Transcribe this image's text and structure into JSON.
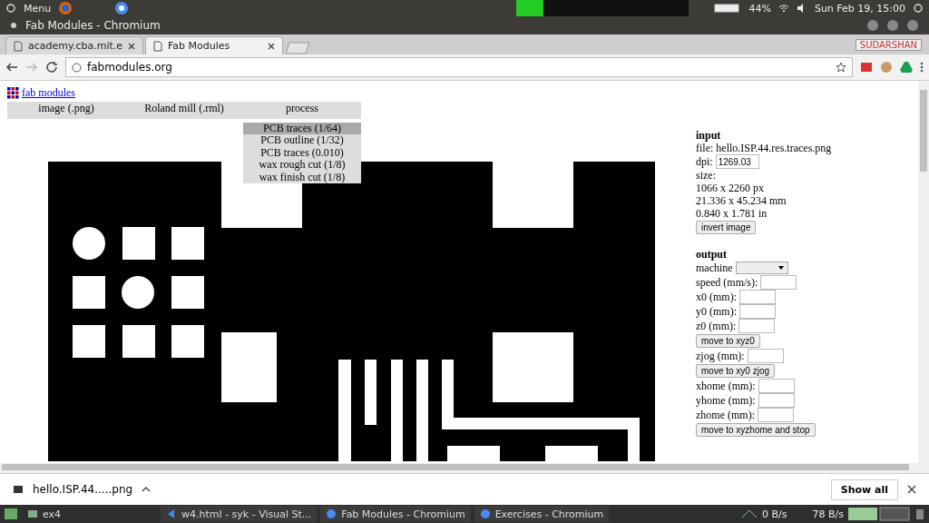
{
  "top_panel": {
    "menu_label": "Menu",
    "battery": "44%",
    "clock": "Sun Feb 19, 15:00"
  },
  "window": {
    "title": "Fab Modules - Chromium"
  },
  "tabs": [
    {
      "label": "academy.cba.mit.e",
      "selected": false
    },
    {
      "label": "Fab Modules",
      "selected": true
    }
  ],
  "profile": {
    "name": "SUDARSHAN"
  },
  "address_bar": {
    "url": "fabmodules.org"
  },
  "page": {
    "logo_link": "fab modules",
    "menubar": [
      "image (.png)",
      "Roland mill (.rml)",
      "process"
    ],
    "process_menu": [
      {
        "label": "PCB traces (1/64)",
        "selected": true
      },
      {
        "label": "PCB outline (1/32)",
        "selected": false
      },
      {
        "label": "PCB traces (0.010)",
        "selected": false
      },
      {
        "label": "wax rough cut (1/8)",
        "selected": false
      },
      {
        "label": "wax finish cut (1/8)",
        "selected": false
      }
    ],
    "input": {
      "heading": "input",
      "file": "file: hello.ISP.44.res.traces.png",
      "dpi_label": "dpi:",
      "dpi_value": "1269.03",
      "size_label": "size:",
      "size_lines": [
        "1066 x 2260 px",
        "21.336 x 45.234 mm",
        "0.840 x 1.781 in"
      ],
      "button": "invert image"
    },
    "output": {
      "heading": "output",
      "rows": [
        {
          "kind": "select",
          "label": "machine"
        },
        {
          "kind": "field",
          "label": "speed (mm/s):"
        },
        {
          "kind": "field",
          "label": "x0 (mm):"
        },
        {
          "kind": "field",
          "label": "y0 (mm):"
        },
        {
          "kind": "field",
          "label": "z0 (mm):"
        },
        {
          "kind": "button",
          "label": "move to xyz0"
        },
        {
          "kind": "field",
          "label": "zjog (mm):"
        },
        {
          "kind": "button",
          "label": "move to xy0 zjog"
        },
        {
          "kind": "field",
          "label": "xhome (mm):"
        },
        {
          "kind": "field",
          "label": "yhome (mm):"
        },
        {
          "kind": "field",
          "label": "zhome (mm):"
        },
        {
          "kind": "button",
          "label": "move to xyzhome and stop"
        }
      ]
    }
  },
  "download_bar": {
    "file": "hello.ISP.44.....png",
    "show_all": "Show all"
  },
  "taskbar": {
    "items": [
      "ex4",
      "w4.html - syk - Visual St...",
      "Fab Modules - Chromium",
      "Exercises - Chromium"
    ],
    "down_speed": "0 B/s",
    "up_speed": "78 B/s"
  }
}
